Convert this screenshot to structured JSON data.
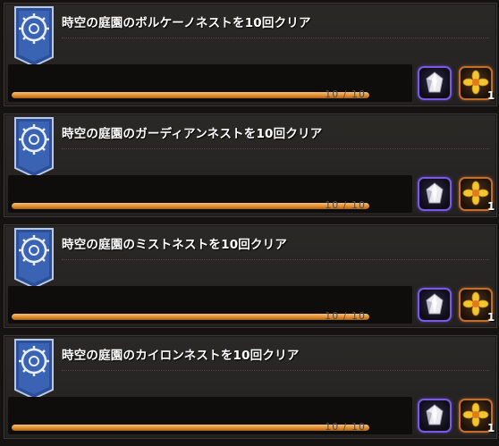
{
  "achievements": [
    {
      "title": "時空の庭園のボルケーノネストを10回クリア",
      "progress_text": "10 / 10",
      "progress_fraction": 1.0,
      "rewards": [
        {
          "type": "crystal-item",
          "icon": "crystal-icon",
          "quantity": ""
        },
        {
          "type": "flower-item",
          "icon": "flower-icon",
          "quantity": "1"
        }
      ]
    },
    {
      "title": "時空の庭園のガーディアンネストを10回クリア",
      "progress_text": "10 / 10",
      "progress_fraction": 1.0,
      "rewards": [
        {
          "type": "crystal-item",
          "icon": "crystal-icon",
          "quantity": ""
        },
        {
          "type": "flower-item",
          "icon": "flower-icon",
          "quantity": "1"
        }
      ]
    },
    {
      "title": "時空の庭園のミストネストを10回クリア",
      "progress_text": "10 / 10",
      "progress_fraction": 1.0,
      "rewards": [
        {
          "type": "crystal-item",
          "icon": "crystal-icon",
          "quantity": ""
        },
        {
          "type": "flower-item",
          "icon": "flower-icon",
          "quantity": "1"
        }
      ]
    },
    {
      "title": "時空の庭園のカイロンネストを10回クリア",
      "progress_text": "10 / 10",
      "progress_fraction": 1.0,
      "rewards": [
        {
          "type": "crystal-item",
          "icon": "crystal-icon",
          "quantity": ""
        },
        {
          "type": "flower-item",
          "icon": "flower-icon",
          "quantity": "1"
        }
      ]
    }
  ],
  "colors": {
    "emblem_blue": "#2c4f9a",
    "bar_orange": "#e08e2d",
    "crystal_border": "#7a5ae0",
    "flower_border": "#c0702e"
  }
}
